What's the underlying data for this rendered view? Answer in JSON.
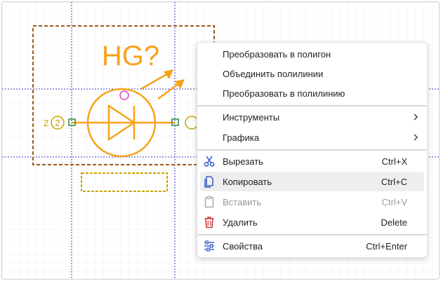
{
  "canvas": {
    "component_label": "HG?",
    "pin_left_text": "2",
    "pin_left_circle": "2",
    "colors": {
      "accent": "#f5a31b",
      "outline": "#9b5a1f",
      "crosshair": "#3a3ac8",
      "grid": "#eeeeee",
      "pin_marker": "#2f8a3e",
      "highlight_circle": "#e040c8",
      "label_box": "#c9a400"
    }
  },
  "context_menu": {
    "items": [
      {
        "label": "Преобразовать в полигон"
      },
      {
        "label": "Объединить полилинии"
      },
      {
        "label": "Преобразовать в полилинию"
      },
      {
        "label": "Инструменты",
        "submenu": true
      },
      {
        "label": "Графика",
        "submenu": true
      },
      {
        "label": "Вырезать",
        "shortcut": "Ctrl+X",
        "icon": "scissors-icon"
      },
      {
        "label": "Копировать",
        "shortcut": "Ctrl+C",
        "icon": "copy-icon",
        "highlighted": true
      },
      {
        "label": "Вставить",
        "shortcut": "Ctrl+V",
        "icon": "clipboard-icon",
        "disabled": true
      },
      {
        "label": "Удалить",
        "shortcut": "Delete",
        "icon": "trash-icon"
      },
      {
        "label": "Свойства",
        "shortcut": "Ctrl+Enter",
        "icon": "sliders-icon"
      }
    ]
  }
}
